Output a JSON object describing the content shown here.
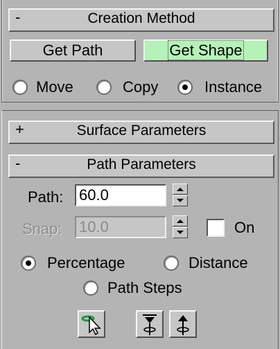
{
  "creation_method": {
    "title": "Creation Method",
    "toggle": "-",
    "get_path_label": "Get Path",
    "get_shape_label": "Get Shape",
    "radios": [
      {
        "label": "Move",
        "checked": false
      },
      {
        "label": "Copy",
        "checked": false
      },
      {
        "label": "Instance",
        "checked": true
      }
    ]
  },
  "surface_parameters": {
    "title": "Surface Parameters",
    "toggle": "+"
  },
  "path_parameters": {
    "title": "Path Parameters",
    "toggle": "-",
    "path_label": "Path:",
    "path_value": "60.0",
    "snap_label": "Snap:",
    "snap_value": "10.0",
    "snap_on_label": "On",
    "radios": [
      {
        "label": "Percentage",
        "checked": true
      },
      {
        "label": "Distance",
        "checked": false
      },
      {
        "label": "Path Steps",
        "checked": false
      }
    ],
    "icons": [
      "pick-shape-icon",
      "align-down-icon",
      "align-up-icon"
    ]
  },
  "colors": {
    "panel": "#b4b4b4",
    "button_active": "#b5f2b8"
  }
}
